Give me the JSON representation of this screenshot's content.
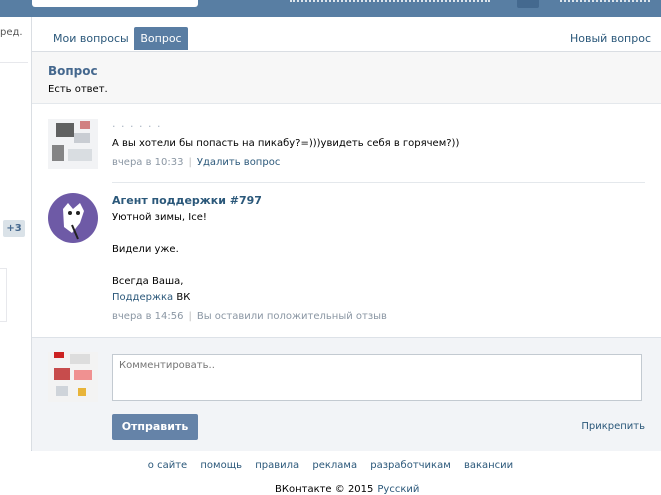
{
  "sidebar": {
    "text_fragment": "ред.",
    "badge": "+3"
  },
  "tabs": {
    "my_questions": "Мои вопросы",
    "question": "Вопрос",
    "new_question": "Новый вопрос"
  },
  "question": {
    "title": "Вопрос",
    "status": "Есть ответ."
  },
  "messages": [
    {
      "author": "· · · · · ·",
      "text": "А вы хотели бы попасть на пикабу?=)))увидеть себя в горячем?))",
      "time": "вчера в 10:33",
      "action": "Удалить вопрос"
    },
    {
      "author": "Агент поддержки #797",
      "greeting": "Уютной зимы, Ice!",
      "line2": "Видели уже.",
      "signoff": "Всегда Ваша,",
      "signature_link": "Поддержка",
      "signature_rest": " ВК",
      "time": "вчера в 14:56",
      "status": "Вы оставили положительный отзыв"
    }
  ],
  "comment": {
    "placeholder": "Комментировать..",
    "send": "Отправить",
    "attach": "Прикрепить"
  },
  "footer": {
    "links": [
      "о сайте",
      "помощь",
      "правила",
      "реклама",
      "разработчикам",
      "вакансии"
    ],
    "copyright": "ВКонтакте © 2015",
    "language": "Русский"
  },
  "colors": {
    "header": "#587ea3",
    "accent": "#2b587a",
    "button": "#6583a8",
    "tab_active": "#597da3"
  }
}
